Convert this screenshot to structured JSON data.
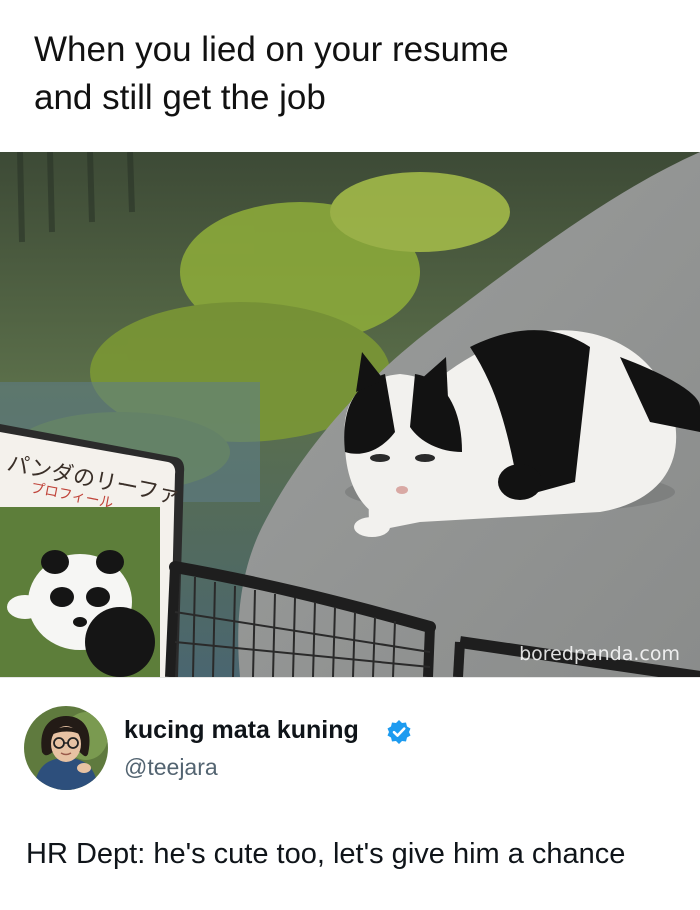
{
  "meme": {
    "caption_line1": "When you lied on your resume",
    "caption_line2": "and still get the job"
  },
  "photo": {
    "sign_title": "パンダのリーファ",
    "sign_subtitle": "プロフィール",
    "watermark": "boredpanda.com"
  },
  "tweet": {
    "display_name": "kucing mata kuning",
    "handle": "@teejara",
    "verified_icon": "verified-badge-icon",
    "text": "HR Dept: he's cute too, let's give him a chance"
  },
  "colors": {
    "verified_blue": "#1d9bf0",
    "handle_gray": "#536471"
  }
}
